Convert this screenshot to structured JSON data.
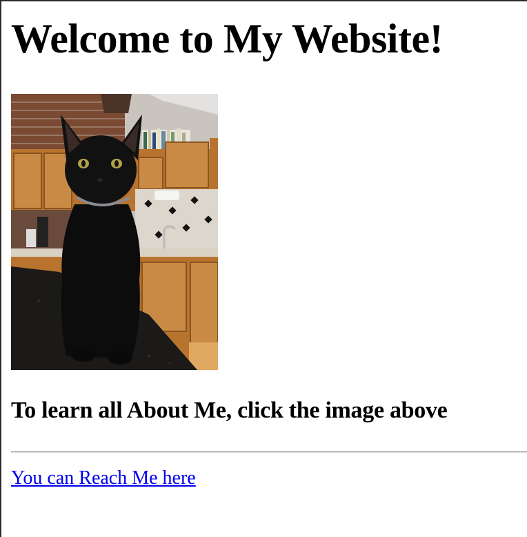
{
  "page": {
    "heading": "Welcome to My Website!",
    "image": {
      "alt": "Black cat sitting on a kitchen counter",
      "link_target": "About Me"
    },
    "subheading": "To learn all About Me, click the image above",
    "contact_link": "You can Reach Me here"
  },
  "colors": {
    "link": "#0000ee",
    "text": "#000000",
    "background": "#ffffff"
  }
}
